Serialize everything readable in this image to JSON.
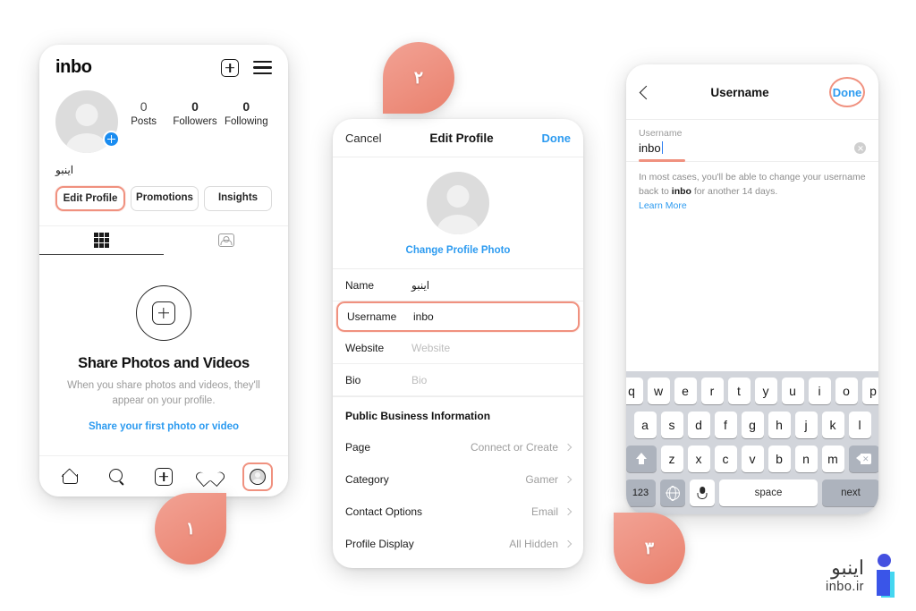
{
  "phone1": {
    "app_title": "inbo",
    "icons": {
      "new_post": "plus-box-icon",
      "menu": "hamburger-icon"
    },
    "stats": [
      {
        "value": "0",
        "label": "Posts"
      },
      {
        "value": "0",
        "label": "Followers"
      },
      {
        "value": "0",
        "label": "Following"
      }
    ],
    "display_name": "اینبو",
    "buttons": [
      {
        "label": "Edit Profile",
        "highlighted": true
      },
      {
        "label": "Promotions",
        "highlighted": false
      },
      {
        "label": "Insights",
        "highlighted": false
      }
    ],
    "tabs": [
      {
        "name": "grid-tab",
        "active": true
      },
      {
        "name": "tagged-tab",
        "active": false
      }
    ],
    "empty_state": {
      "title": "Share Photos and Videos",
      "subtitle": "When you share photos and videos, they'll appear on your profile.",
      "link": "Share your first photo or video"
    },
    "nav": [
      {
        "name": "home-icon",
        "highlighted": false
      },
      {
        "name": "search-icon",
        "highlighted": false
      },
      {
        "name": "add-post-icon",
        "highlighted": false
      },
      {
        "name": "activity-heart-icon",
        "highlighted": false
      },
      {
        "name": "profile-icon",
        "highlighted": true
      }
    ]
  },
  "phone2": {
    "cancel_label": "Cancel",
    "title": "Edit Profile",
    "done_label": "Done",
    "change_photo_label": "Change Profile Photo",
    "fields": [
      {
        "label": "Name",
        "value": "اینبو",
        "placeholder": false,
        "rtl": true,
        "highlighted": false
      },
      {
        "label": "Username",
        "value": "inbo",
        "placeholder": false,
        "rtl": false,
        "highlighted": true
      },
      {
        "label": "Website",
        "value": "Website",
        "placeholder": true,
        "rtl": false,
        "highlighted": false
      },
      {
        "label": "Bio",
        "value": "Bio",
        "placeholder": true,
        "rtl": false,
        "highlighted": false
      }
    ],
    "section_header": "Public Business Information",
    "list_rows": [
      {
        "label": "Page",
        "value": "Connect or Create"
      },
      {
        "label": "Category",
        "value": "Gamer"
      },
      {
        "label": "Contact Options",
        "value": "Email"
      },
      {
        "label": "Profile Display",
        "value": "All Hidden"
      }
    ]
  },
  "phone3": {
    "back_icon": "back-chevron-icon",
    "title": "Username",
    "done_label": "Done",
    "field_label": "Username",
    "field_value": "inbo",
    "note_prefix": "In most cases, you'll be able to change your username back to ",
    "note_bold": "inbo",
    "note_suffix": " for another 14 days.",
    "learn_more": "Learn More",
    "keyboard": {
      "row1": [
        "q",
        "w",
        "e",
        "r",
        "t",
        "y",
        "u",
        "i",
        "o",
        "p"
      ],
      "row2": [
        "a",
        "s",
        "d",
        "f",
        "g",
        "h",
        "j",
        "k",
        "l"
      ],
      "row3": [
        "z",
        "x",
        "c",
        "v",
        "b",
        "n",
        "m"
      ],
      "shift_icon": "shift-icon",
      "delete_icon": "backspace-icon",
      "numbers_key": "123",
      "globe_icon": "globe-icon",
      "mic_icon": "microphone-icon",
      "space_key": "space",
      "next_key": "next"
    }
  },
  "steps": [
    {
      "number": "۱"
    },
    {
      "number": "۲"
    },
    {
      "number": "۳"
    }
  ],
  "logo": {
    "name_fa": "اینبو",
    "name_en": "inbo.ir"
  },
  "colors": {
    "highlight": "#f0917f",
    "link_blue": "#2d9bf0",
    "brand_blue": "#3a55e8",
    "brand_cyan": "#45d6f0"
  }
}
